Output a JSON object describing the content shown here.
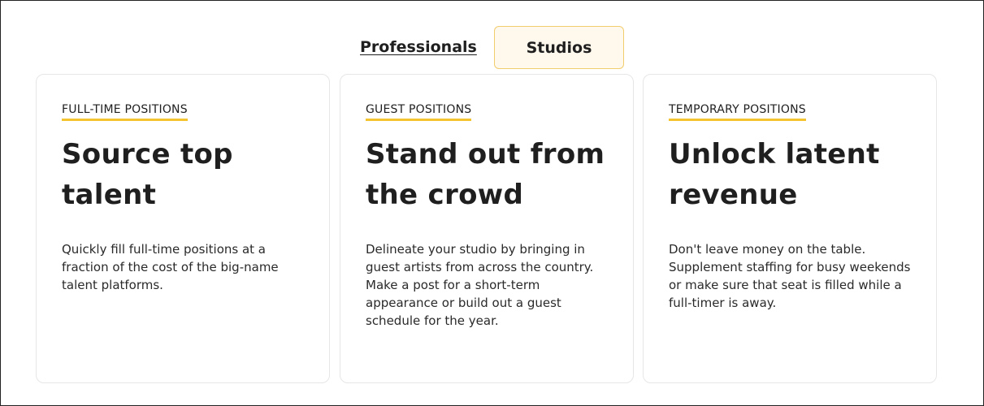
{
  "tabs": {
    "professionals": "Professionals",
    "studios": "Studios"
  },
  "cards": [
    {
      "eyebrow": "FULL-TIME POSITIONS",
      "heading_line1": "Source top",
      "heading_line2": "talent",
      "body": "Quickly fill full-time positions at a fraction of the cost of the big-name talent platforms."
    },
    {
      "eyebrow": "GUEST POSITIONS",
      "heading_line1": "Stand out from",
      "heading_line2": "the crowd",
      "body": "Delineate your studio by bringing in guest artists from across the country. Make a post for a short-term appearance or build out a guest schedule for the year."
    },
    {
      "eyebrow": "TEMPORARY POSITIONS",
      "heading_line1": "Unlock latent",
      "heading_line2": "revenue",
      "body": "Don't leave money on the table. Supplement staffing for busy weekends or make sure that seat is filled while a full-timer is away."
    }
  ],
  "colors": {
    "accent": "#f4c330",
    "active_tab_bg": "#fff8ec",
    "active_tab_border": "#f2cd6e"
  }
}
